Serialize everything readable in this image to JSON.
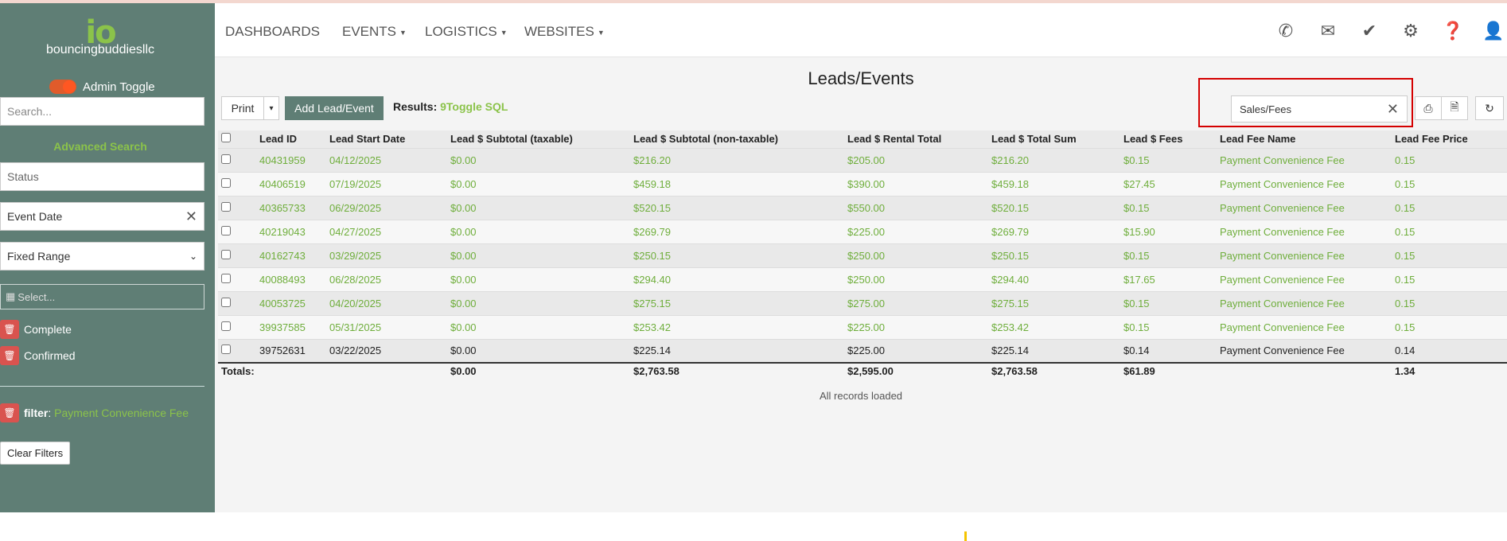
{
  "sidebar": {
    "logo": "io",
    "brand": "bouncingbuddiesllc",
    "admin_toggle": "Admin Toggle",
    "search_placeholder": "Search...",
    "advanced_search": "Advanced Search",
    "status_placeholder": "Status",
    "event_date": "Event Date",
    "range_select": "Fixed Range",
    "date_placeholder": "Select...",
    "status_pills": [
      "Complete",
      "Confirmed"
    ],
    "filter_label": "filter",
    "filter_value": "Payment Convenience Fee",
    "clear_filters": "Clear Filters"
  },
  "nav": {
    "items": [
      "DASHBOARDS",
      "EVENTS",
      "LOGISTICS",
      "WEBSITES"
    ],
    "icons": [
      "phone-icon",
      "envelope-icon",
      "check-icon",
      "gear-icon",
      "help-icon",
      "user-icon"
    ]
  },
  "main": {
    "title": "Leads/Events",
    "print": "Print",
    "add_lead": "Add Lead/Event",
    "results_label": "Results:",
    "results_count": "9",
    "toggle_sql": "Toggle SQL",
    "search_value": "Sales/Fees",
    "all_loaded": "All records loaded"
  },
  "table": {
    "headers": [
      "Lead ID",
      "Lead Start Date",
      "Lead $ Subtotal (taxable)",
      "Lead $ Subtotal (non-taxable)",
      "Lead $ Rental Total",
      "Lead $ Total Sum",
      "Lead $ Fees",
      "Lead Fee Name",
      "Lead Fee Price"
    ],
    "rows": [
      [
        "40431959",
        "04/12/2025",
        "$0.00",
        "$216.20",
        "$205.00",
        "$216.20",
        "$0.15",
        "Payment Convenience Fee",
        "0.15"
      ],
      [
        "40406519",
        "07/19/2025",
        "$0.00",
        "$459.18",
        "$390.00",
        "$459.18",
        "$27.45",
        "Payment Convenience Fee",
        "0.15"
      ],
      [
        "40365733",
        "06/29/2025",
        "$0.00",
        "$520.15",
        "$550.00",
        "$520.15",
        "$0.15",
        "Payment Convenience Fee",
        "0.15"
      ],
      [
        "40219043",
        "04/27/2025",
        "$0.00",
        "$269.79",
        "$225.00",
        "$269.79",
        "$15.90",
        "Payment Convenience Fee",
        "0.15"
      ],
      [
        "40162743",
        "03/29/2025",
        "$0.00",
        "$250.15",
        "$250.00",
        "$250.15",
        "$0.15",
        "Payment Convenience Fee",
        "0.15"
      ],
      [
        "40088493",
        "06/28/2025",
        "$0.00",
        "$294.40",
        "$250.00",
        "$294.40",
        "$17.65",
        "Payment Convenience Fee",
        "0.15"
      ],
      [
        "40053725",
        "04/20/2025",
        "$0.00",
        "$275.15",
        "$275.00",
        "$275.15",
        "$0.15",
        "Payment Convenience Fee",
        "0.15"
      ],
      [
        "39937585",
        "05/31/2025",
        "$0.00",
        "$253.42",
        "$225.00",
        "$253.42",
        "$0.15",
        "Payment Convenience Fee",
        "0.15"
      ],
      [
        "39752631",
        "03/22/2025",
        "$0.00",
        "$225.14",
        "$225.00",
        "$225.14",
        "$0.14",
        "Payment Convenience Fee",
        "0.14"
      ]
    ],
    "totals": [
      "Totals:",
      "",
      "$0.00",
      "$2,763.58",
      "$2,595.00",
      "$2,763.58",
      "$61.89",
      "",
      "1.34"
    ]
  },
  "colors": {
    "sidebar": "#5f7e75",
    "accent": "#8bc34a",
    "danger": "#d9534f",
    "highlight": "#d40000"
  }
}
